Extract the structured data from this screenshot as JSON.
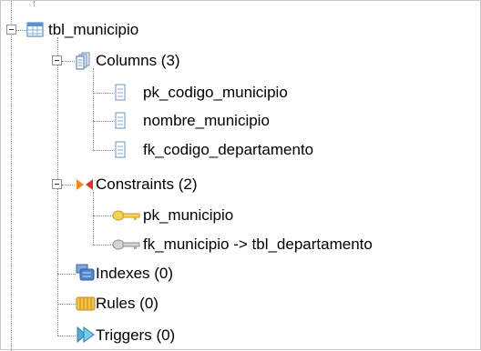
{
  "tree": {
    "table": {
      "label": "tbl_municipio",
      "icon": "table-icon"
    },
    "columns": {
      "label": "Columns (3)",
      "icon": "columns-icon",
      "items": [
        {
          "label": "pk_codigo_municipio",
          "icon": "column-icon"
        },
        {
          "label": "nombre_municipio",
          "icon": "column-icon"
        },
        {
          "label": "fk_codigo_departamento",
          "icon": "column-icon"
        }
      ]
    },
    "constraints": {
      "label": "Constraints (2)",
      "icon": "constraints-icon",
      "items": [
        {
          "label": "pk_municipio",
          "icon": "primary-key-icon"
        },
        {
          "label": "fk_municipio -> tbl_departamento",
          "icon": "foreign-key-icon"
        }
      ]
    },
    "indexes": {
      "label": "Indexes (0)",
      "icon": "indexes-icon"
    },
    "rules": {
      "label": "Rules (0)",
      "icon": "rules-icon"
    },
    "triggers": {
      "label": "Triggers (0)",
      "icon": "triggers-icon"
    }
  },
  "colors": {
    "connector": "#8a8a8a",
    "column_icon": "#6f8fb8",
    "key_primary": "#e3b83a",
    "key_foreign": "#a9a9a9",
    "constraint_icon": "#d9342b"
  }
}
